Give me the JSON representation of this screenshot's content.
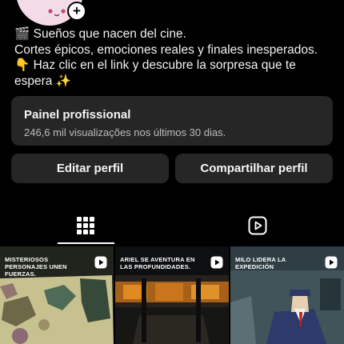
{
  "bio": {
    "line1": "🎬 Sueños que nacen del cine.",
    "line2": "Cortes épicos, emociones reales y finales inesperados.",
    "line3": "👇 Haz clic en el link y descubre la sorpresa que te",
    "line4": "espera ✨"
  },
  "dashboard": {
    "title": "Painel profissional",
    "subtitle": "246,6 mil visualizações nos últimos 30 dias."
  },
  "buttons": {
    "edit_profile": "Editar perfil",
    "share_profile": "Compartilhar perfil"
  },
  "tabs": {
    "grid_icon": "grid-icon",
    "reels_icon": "reels-icon",
    "active": "grid"
  },
  "grid": [
    {
      "caption": "MISTERIOSOS PERSONAJES UNEN FUERZAS.",
      "type_icon": "reel-icon"
    },
    {
      "caption": "ARIEL SE AVENTURA EN LAS PROFUNDIDADES.",
      "type_icon": "reel-icon"
    },
    {
      "caption": "MILO LIDERA LA EXPEDICIÓN",
      "type_icon": "reel-icon"
    }
  ],
  "colors": {
    "background": "#000000",
    "card": "#262626",
    "text": "#f5f5f5",
    "secondary_text": "#bdbdbd"
  }
}
